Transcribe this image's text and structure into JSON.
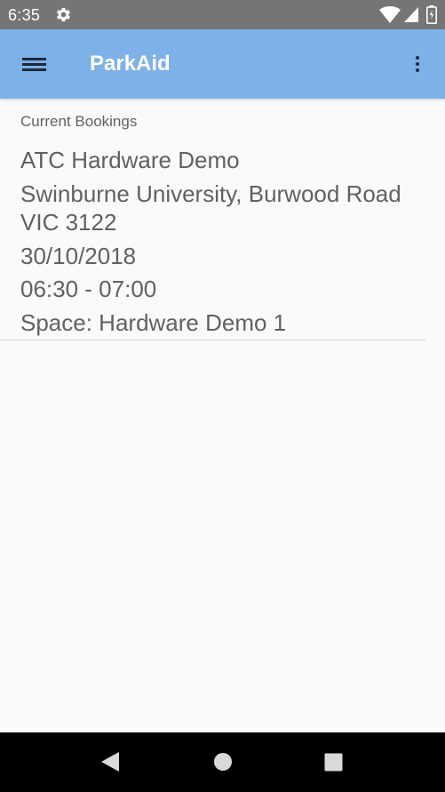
{
  "status_bar": {
    "time": "6:35",
    "icons": [
      "gear-icon",
      "wifi-icon",
      "signal-icon",
      "battery-icon"
    ]
  },
  "app_bar": {
    "title": "ParkAid",
    "background_color": "#7db1e8",
    "icons": [
      "menu-icon",
      "more-vert-icon"
    ]
  },
  "content": {
    "section_header": "Current Bookings",
    "bookings": [
      {
        "name": "ATC Hardware Demo",
        "address_line1": "Swinburne University, Burwood Road",
        "address_line2": "VIC 3122",
        "date": "30/10/2018",
        "time": "06:30 - 07:00",
        "space": "Space: Hardware Demo 1"
      }
    ]
  },
  "nav_bar": {
    "icons": [
      "back-icon",
      "home-icon",
      "recent-apps-icon"
    ]
  }
}
